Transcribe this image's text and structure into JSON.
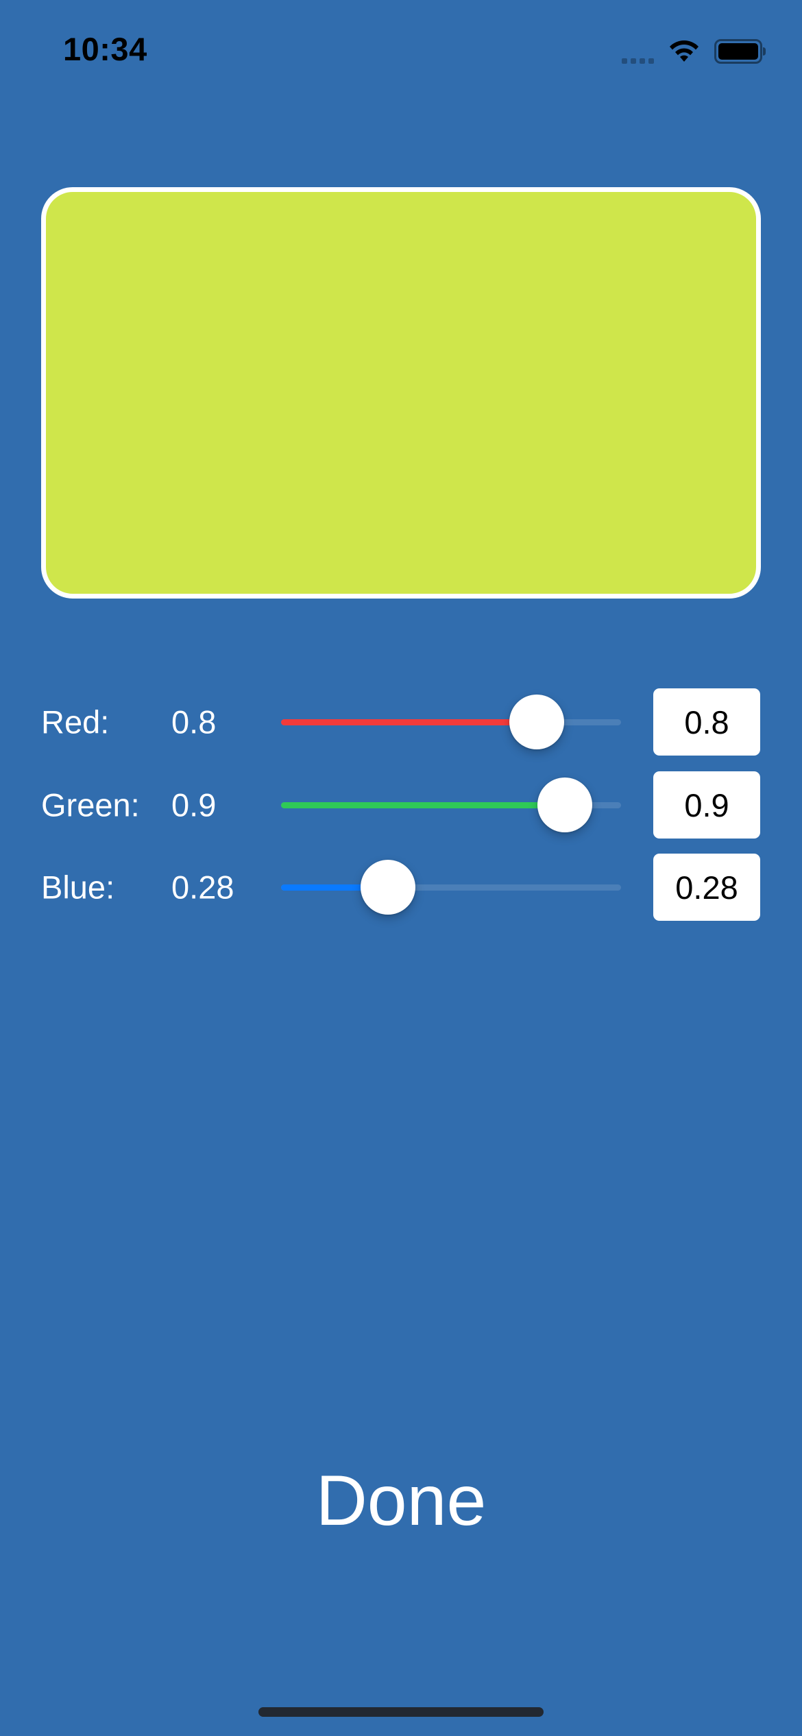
{
  "status_bar": {
    "time": "10:34",
    "icons": [
      "cellular-signal-icon",
      "wifi-icon",
      "battery-icon"
    ]
  },
  "preview": {
    "color": "#CFE64B",
    "border_color": "#FFFFFF"
  },
  "sliders": [
    {
      "label": "Red:",
      "value_text": "0.8",
      "input_value": "0.8",
      "value": 0.8,
      "fill_color": "#F23B3B"
    },
    {
      "label": "Green:",
      "value_text": "0.9",
      "input_value": "0.9",
      "value": 0.9,
      "fill_color": "#2FC957"
    },
    {
      "label": "Blue:",
      "value_text": "0.28",
      "input_value": "0.28",
      "value": 0.28,
      "fill_color": "#0A7AFF"
    }
  ],
  "done_button": {
    "label": "Done"
  },
  "colors": {
    "background": "#316DAE",
    "text": "#FFFFFF"
  }
}
